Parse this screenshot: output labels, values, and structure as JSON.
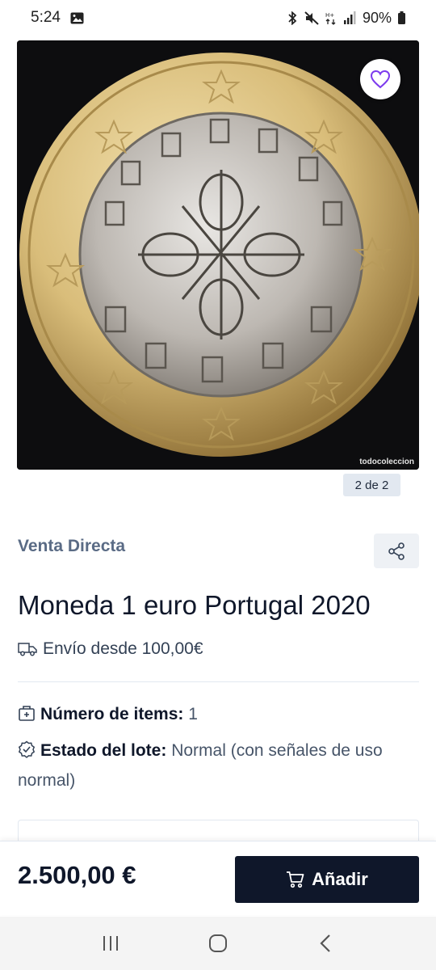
{
  "status_bar": {
    "time": "5:24",
    "battery": "90%",
    "icons": [
      "image-icon",
      "bluetooth-icon",
      "mute-icon",
      "data-icon",
      "signal-icon",
      "battery-icon"
    ]
  },
  "gallery": {
    "counter": "2 de 2",
    "watermark": "todocoleccion",
    "favorite_icon": "heart-icon"
  },
  "listing": {
    "sale_type": "Venta Directa",
    "share_icon": "share-icon",
    "title": "Moneda 1 euro Portugal 2020",
    "shipping": "Envío desde 100,00€",
    "items_label": "Número de items:",
    "items_value": " 1",
    "state_label": "Estado del lote:",
    "state_value": " Normal (con señales de uso normal)"
  },
  "buy_bar": {
    "price": "2.500,00 €",
    "add_label": "Añadir"
  },
  "colors": {
    "primary": "#0f172a",
    "muted": "#5a6b85",
    "favorite": "#7c3aed"
  }
}
